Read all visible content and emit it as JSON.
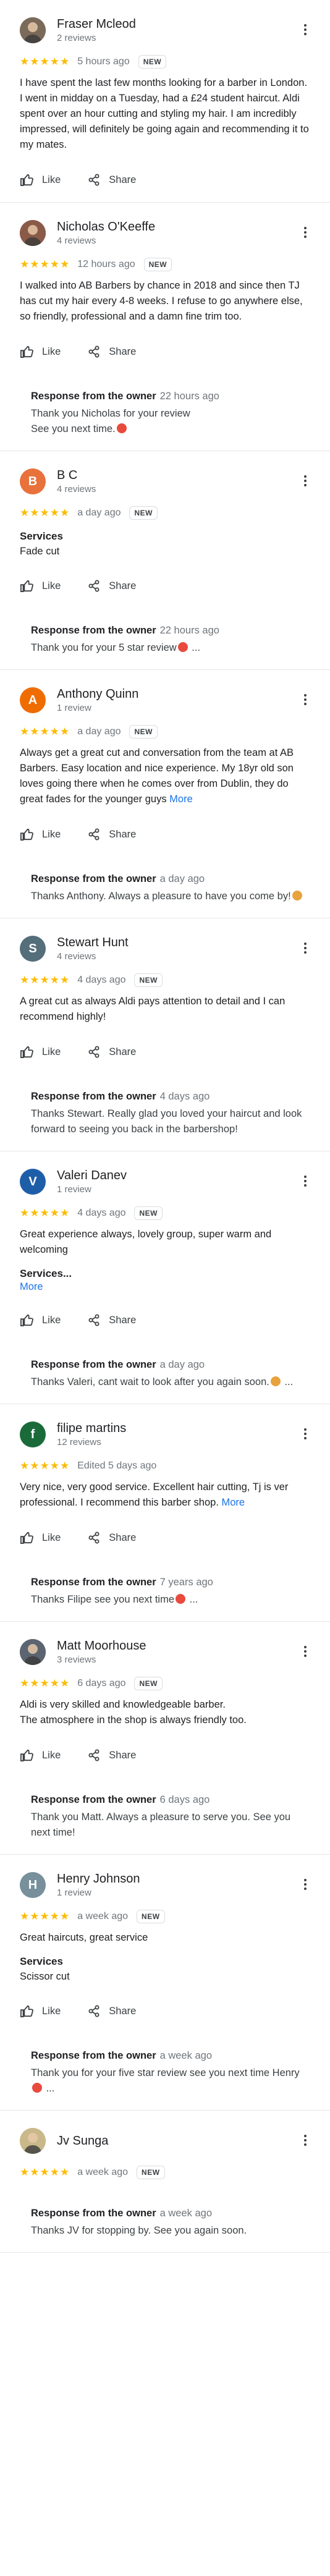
{
  "actions": {
    "like": "Like",
    "share": "Share"
  },
  "badges": {
    "new": "NEW"
  },
  "owner_label": "Response from the owner",
  "reviews": [
    {
      "name": "Fraser Mcleod",
      "count": "2 reviews",
      "stars": "★★★★★",
      "when": "5 hours ago",
      "is_new": true,
      "avatar_color": "#7a6a5a",
      "text": "I have spent the last few months looking for a  barber in London. I went in midday on a Tuesday, had a £24 student haircut. Aldi spent over an hour cutting and styling my hair. I am incredibly impressed, will definitely be going again and recommending it to my mates."
    },
    {
      "name": "Nicholas O'Keeffe",
      "count": "4 reviews",
      "stars": "★★★★★",
      "when": "12 hours ago",
      "is_new": true,
      "avatar_color": "#8a5a48",
      "text": "I walked into AB Barbers by chance in 2018 and since then TJ has cut my hair every 4-8 weeks. I refuse to go anywhere else, so friendly, professional and a damn fine trim too.",
      "owner": {
        "when": "22 hours ago",
        "text": "Thank you Nicholas for your review\nSee you next time.",
        "emoji": "#e84a3d"
      }
    },
    {
      "name": "B C",
      "count": "4 reviews",
      "stars": "★★★★★",
      "when": "a day ago",
      "is_new": true,
      "avatar_color": "#e8713c",
      "initial": "B",
      "services_label": "Services",
      "services_value": "Fade cut",
      "owner": {
        "when": "22 hours ago",
        "text": "Thank you for your 5 star review",
        "emoji": "#e84a3d",
        "ellipsis": " ..."
      }
    },
    {
      "name": "Anthony Quinn",
      "count": "1 review",
      "stars": "★★★★★",
      "when": "a day ago",
      "is_new": true,
      "avatar_color": "#ef6c00",
      "initial": "A",
      "text": "Always get a great cut and conversation from the team at AB Barbers. Easy location and nice experience. My 18yr old son loves going there when he comes over from Dublin, they do great fades for the younger guys",
      "more": "More",
      "owner": {
        "when": "a day ago",
        "text": "Thanks Anthony. Always a pleasure to have you come by!",
        "emoji": "#e8a33d"
      }
    },
    {
      "name": "Stewart Hunt",
      "count": "4 reviews",
      "stars": "★★★★★",
      "when": "4 days ago",
      "is_new": true,
      "avatar_color": "#546e7a",
      "initial": "S",
      "text": "A great cut as always Aldi pays attention to detail and I can recommend highly!",
      "owner": {
        "when": "4 days ago",
        "text": "Thanks Stewart. Really glad you loved your haircut and look forward to seeing you back in the barbershop!"
      }
    },
    {
      "name": "Valeri Danev",
      "count": "1 review",
      "stars": "★★★★★",
      "when": "4 days ago",
      "is_new": true,
      "avatar_color": "#1e5ea8",
      "initial": "V",
      "text": "Great experience always, lovely group, super warm and welcoming",
      "services_label": "Services...",
      "more": "More",
      "owner": {
        "when": "a day ago",
        "text": "Thanks Valeri, cant wait to look after you again soon.",
        "emoji": "#e8a33d",
        "ellipsis": " ..."
      }
    },
    {
      "name": "filipe martins",
      "count": "12 reviews",
      "stars": "★★★★★",
      "when": "Edited 5 days ago",
      "is_new": false,
      "avatar_color": "#1b6b3a",
      "initial": "f",
      "text": "Very nice,  very good service. Excellent hair cutting, Tj is ver professional. I recommend this barber shop.",
      "more": "More",
      "owner": {
        "when": "7 years ago",
        "text": "Thanks Filipe see you next time",
        "emoji": "#e84a3d",
        "ellipsis": " ..."
      }
    },
    {
      "name": "Matt Moorhouse",
      "count": "3 reviews",
      "stars": "★★★★★",
      "when": "6 days ago",
      "is_new": true,
      "avatar_color": "#5b6470",
      "text": "Aldi is very skilled and knowledgeable barber.\nThe atmosphere in the shop is always friendly too.",
      "owner": {
        "when": "6 days ago",
        "text": "Thank you Matt. Always a pleasure to serve you. See you next time!"
      }
    },
    {
      "name": "Henry Johnson",
      "count": "1 review",
      "stars": "★★★★★",
      "when": "a week ago",
      "is_new": true,
      "avatar_color": "#78909c",
      "initial": "H",
      "text": "Great haircuts, great service",
      "services_label": "Services",
      "services_value": "Scissor cut",
      "owner": {
        "when": "a week ago",
        "text": "Thank you for your five star review see you next time Henry",
        "emoji": "#e84a3d",
        "ellipsis": " ..."
      }
    },
    {
      "name": "Jv Sunga",
      "count": "",
      "stars": "★★★★★",
      "when": "a week ago",
      "is_new": true,
      "avatar_color": "#c9b98a",
      "owner": {
        "when": "a week ago",
        "text": "Thanks JV for stopping by. See you again soon."
      }
    }
  ]
}
